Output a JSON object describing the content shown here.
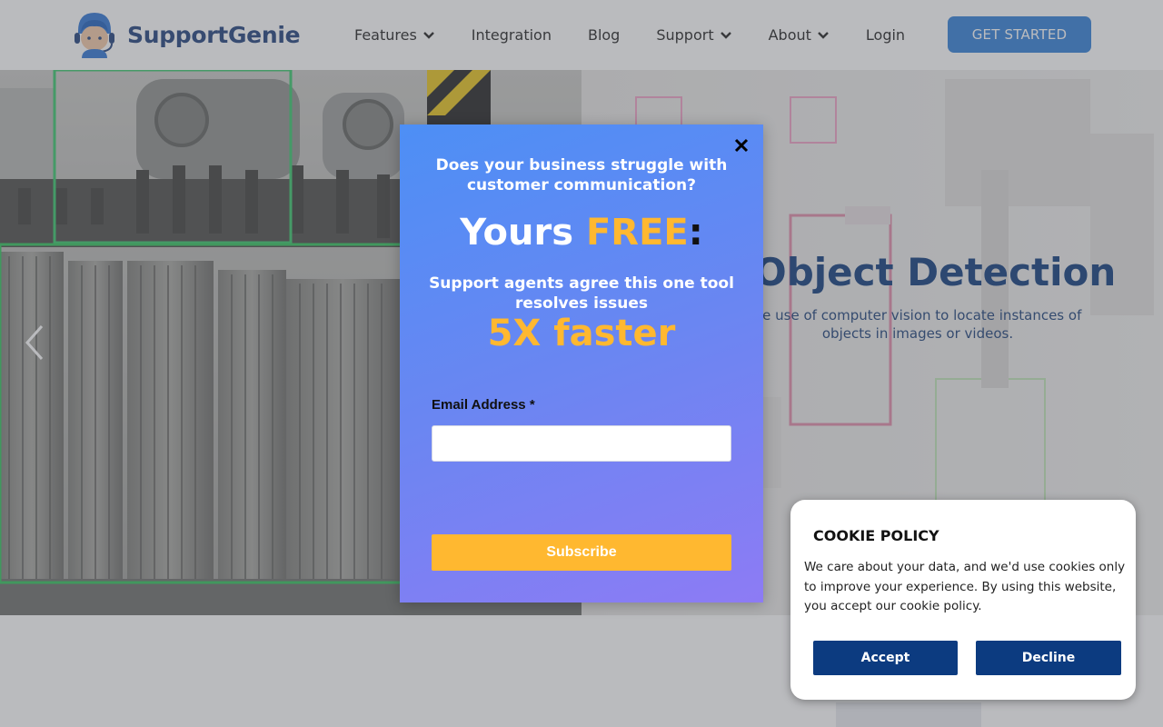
{
  "header": {
    "brand": "SupportGenie",
    "nav": [
      {
        "label": "Features",
        "has_dropdown": true
      },
      {
        "label": "Integration",
        "has_dropdown": false
      },
      {
        "label": "Blog",
        "has_dropdown": false
      },
      {
        "label": "Support",
        "has_dropdown": true
      },
      {
        "label": "About",
        "has_dropdown": true
      },
      {
        "label": "Login",
        "has_dropdown": false
      }
    ],
    "cta": "GET STARTED"
  },
  "hero": {
    "title": "Object Detection",
    "subtitle": "he use of computer vision to locate instances of objects in images or videos."
  },
  "popup": {
    "question": "Does your business struggle with customer communication?",
    "free_prefix": "Yours ",
    "free_highlight": "FREE",
    "free_suffix": ":",
    "agree": "Support agents agree this one tool resolves issues",
    "faster": "5X faster",
    "email_label": "Email Address *",
    "email_value": "",
    "email_placeholder": "",
    "submit": "Subscribe"
  },
  "cookie": {
    "title": "COOKIE POLICY",
    "text": "We care about your data, and we'd use cookies only to improve your experience. By using this website, you accept our cookie policy.",
    "accept": "Accept",
    "decline": "Decline"
  },
  "colors": {
    "brand": "#1e3f7a",
    "cta": "#2f7ed8",
    "accent": "#ffb830",
    "cookie_button": "#0c3b80",
    "popup_gradient_start": "#4d8ff5",
    "popup_gradient_end": "#8d7bf4"
  },
  "icons": {
    "logo": "support-agent-headset-icon",
    "dropdown": "chevron-down-icon",
    "close": "close-icon",
    "carousel_prev": "chevron-left-icon"
  }
}
